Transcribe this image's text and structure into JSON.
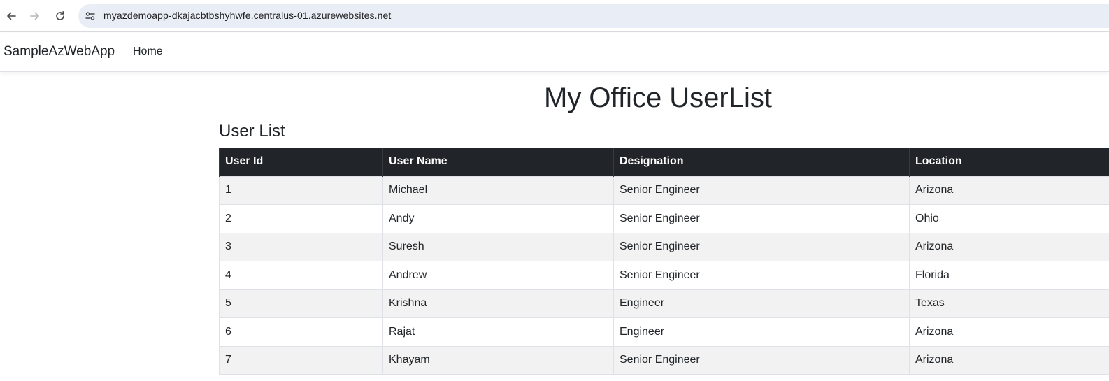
{
  "browser": {
    "url": "myazdemoapp-dkajacbtbshyhwfe.centralus-01.azurewebsites.net"
  },
  "navbar": {
    "brand": "SampleAzWebApp",
    "links": [
      {
        "label": "Home"
      }
    ]
  },
  "main": {
    "title": "My Office UserList",
    "section_title": "User List",
    "table": {
      "columns": [
        "User Id",
        "User Name",
        "Designation",
        "Location"
      ],
      "rows": [
        [
          "1",
          "Michael",
          "Senior Engineer",
          "Arizona"
        ],
        [
          "2",
          "Andy",
          "Senior Engineer",
          "Ohio"
        ],
        [
          "3",
          "Suresh",
          "Senior Engineer",
          "Arizona"
        ],
        [
          "4",
          "Andrew",
          "Senior Engineer",
          "Florida"
        ],
        [
          "5",
          "Krishna",
          "Engineer",
          "Texas"
        ],
        [
          "6",
          "Rajat",
          "Engineer",
          "Arizona"
        ],
        [
          "7",
          "Khayam",
          "Senior Engineer",
          "Arizona"
        ]
      ]
    }
  },
  "colors": {
    "table_header_bg": "#212529",
    "row_stripe": "#f2f2f2",
    "omnibox_bg": "#e9eef6"
  },
  "icons": {
    "back": "arrow-left-icon",
    "forward": "arrow-right-icon",
    "reload": "reload-icon",
    "site_info": "site-settings-icon"
  }
}
